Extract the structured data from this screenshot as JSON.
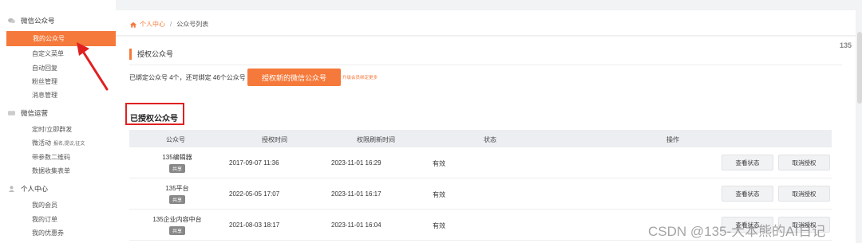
{
  "sidebar": {
    "groups": [
      {
        "icon": "chat-icon",
        "title": "微信公众号",
        "items": [
          {
            "label": "我的公众号",
            "active": true
          },
          {
            "label": "自定义菜单"
          },
          {
            "label": "自动回复"
          },
          {
            "label": "粉丝管理"
          },
          {
            "label": "消息管理"
          }
        ]
      },
      {
        "icon": "card-icon",
        "title": "微信运营",
        "items": [
          {
            "label": "定时/立即群发"
          },
          {
            "label": "微活动",
            "sub": "报名,提议,征文"
          },
          {
            "label": "带参数二维码"
          },
          {
            "label": "数据收集表单"
          }
        ]
      },
      {
        "icon": "user-icon",
        "title": "个人中心",
        "items": [
          {
            "label": "我的会员"
          },
          {
            "label": "我的订单"
          },
          {
            "label": "我的优惠券"
          }
        ]
      }
    ]
  },
  "breadcrumb": {
    "home": "个人中心",
    "sep": "/",
    "current": "公众号列表"
  },
  "section": {
    "title": "授权公众号",
    "bind_info": "已绑定公众号 4个，还可绑定 46个公众号",
    "auth_button": "授权新的微信公众号",
    "upgrade_link": "升级会员绑定更多"
  },
  "authorized": {
    "title": "已授权公众号",
    "columns": [
      "公众号",
      "授权时间",
      "权限刷新时间",
      "状态",
      "操作"
    ],
    "rows": [
      {
        "name": "135编辑器",
        "tag": "共享",
        "auth_time": "2017-09-07 11:36",
        "refresh_time": "2023-11-01 16:29",
        "status": "有效",
        "actions": [
          "查看状态",
          "取消授权"
        ]
      },
      {
        "name": "135平台",
        "tag": "共享",
        "auth_time": "2022-05-05 17:07",
        "refresh_time": "2023-11-01 16:17",
        "status": "有效",
        "actions": [
          "查看状态",
          "取消授权"
        ]
      },
      {
        "name": "135企业内容中台",
        "tag": "共享",
        "auth_time": "2021-08-03 18:17",
        "refresh_time": "2023-11-01 16:04",
        "status": "有效",
        "actions": [
          "查看状态",
          "取消授权"
        ]
      }
    ]
  },
  "side_widget": "135",
  "watermark": "CSDN @135-大本熊的AI日记",
  "colors": {
    "accent": "#f5793a",
    "highlight_box": "#e02020",
    "arrow": "#e02020"
  }
}
